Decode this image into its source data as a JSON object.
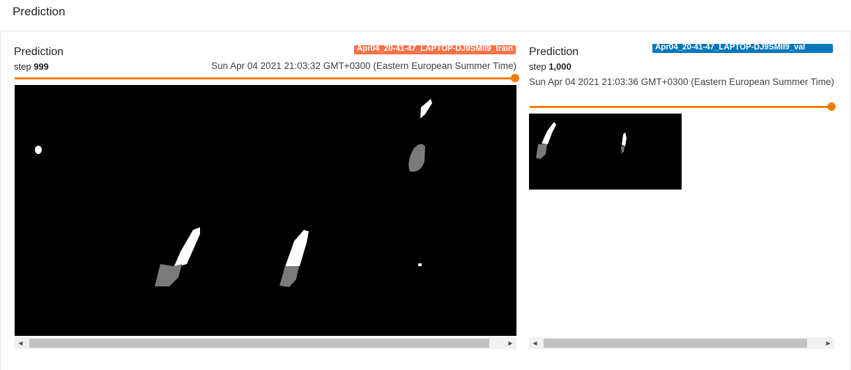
{
  "section": {
    "title": "Prediction"
  },
  "cards": [
    {
      "title": "Prediction",
      "run": "Apr04_20-41-47_LAPTOP-DJ9SMII9_train",
      "run_color": "#ff7043",
      "step_label": "step",
      "step_value": "999",
      "wall_time": "Sun Apr 04 2021 21:03:32 GMT+0300 (Eastern European Summer Time)",
      "slider_value": 1.0,
      "scroll_left_arrow": "◀",
      "scroll_right_arrow": "▶"
    },
    {
      "title": "Prediction",
      "run": "Apr04_20-41-47_LAPTOP-DJ9SMII9_val",
      "run_color": "#0277bd",
      "step_label": "step",
      "step_value": "1,000",
      "wall_time": "Sun Apr 04 2021 21:03:36 GMT+0300 (Eastern European Summer Time)",
      "slider_value": 1.0,
      "scroll_left_arrow": "◀",
      "scroll_right_arrow": "▶"
    }
  ]
}
